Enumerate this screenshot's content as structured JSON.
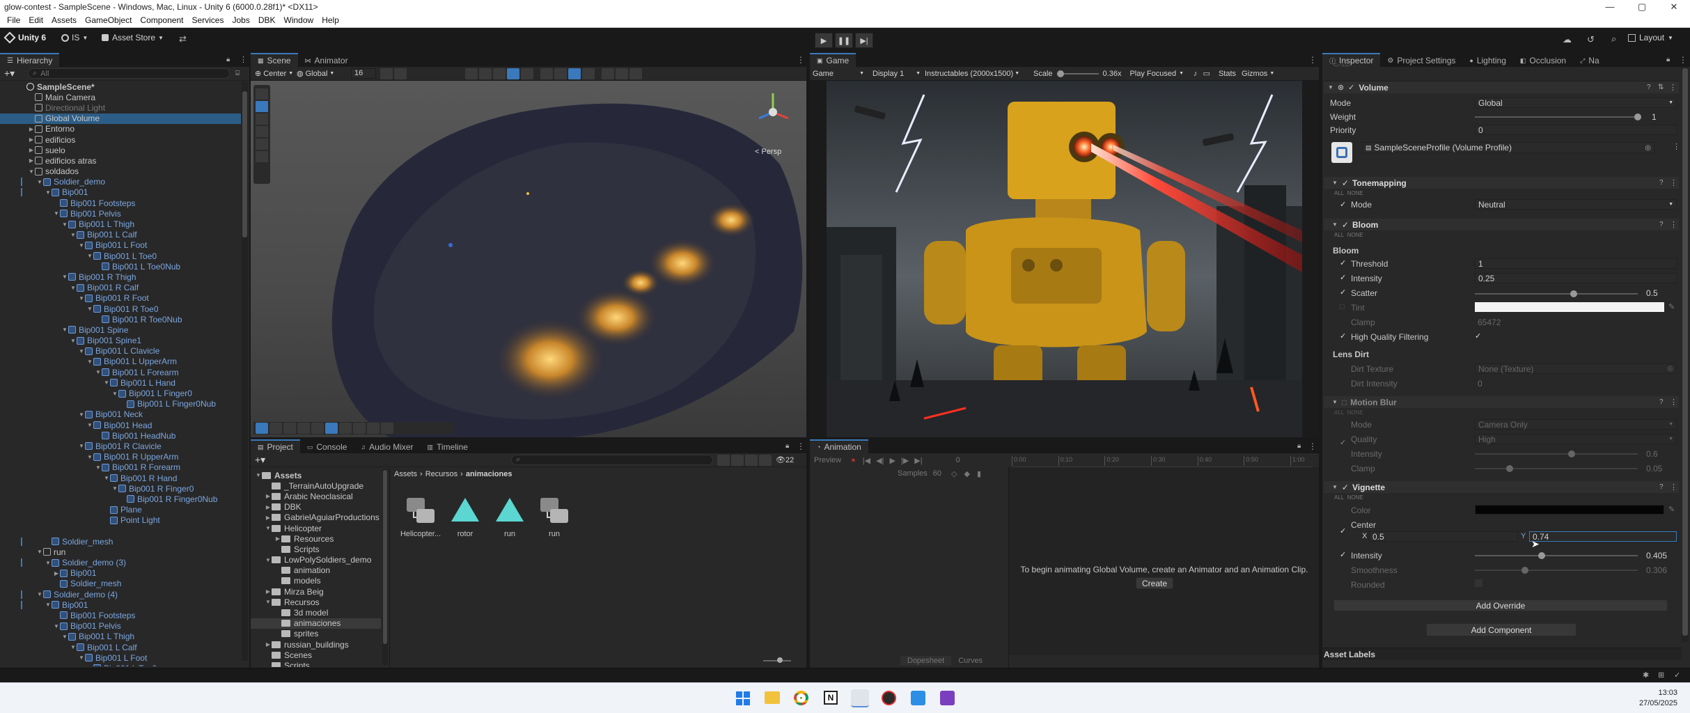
{
  "window": {
    "title": "glow-contest - SampleScene - Windows, Mac, Linux - Unity 6 (6000.0.28f1)* <DX11>",
    "min": "—",
    "max": "▢",
    "close": "✕"
  },
  "menu": [
    "File",
    "Edit",
    "Assets",
    "GameObject",
    "Component",
    "Services",
    "Jobs",
    "DBK",
    "Window",
    "Help"
  ],
  "toolbar": {
    "unity": "Unity 6",
    "account": "IS",
    "asset_store": "Asset Store",
    "layout": "Layout"
  },
  "hierarchy": {
    "tab": "Hierarchy",
    "search_placeholder": "All",
    "rows": [
      {
        "d": 0,
        "t": "SampleScene*",
        "k": "scene"
      },
      {
        "d": 1,
        "t": "Main Camera"
      },
      {
        "d": 1,
        "t": "Directional Light",
        "k": "gray"
      },
      {
        "d": 1,
        "t": "Global Volume",
        "k": "sel"
      },
      {
        "d": 1,
        "t": "Entorno",
        "a": "▶"
      },
      {
        "d": 1,
        "t": "edificios",
        "a": "▶"
      },
      {
        "d": 1,
        "t": "suelo",
        "a": "▶"
      },
      {
        "d": 1,
        "t": "edificios atras",
        "a": "▶"
      },
      {
        "d": 1,
        "t": "soldados",
        "a": "▼"
      },
      {
        "d": 2,
        "t": "Soldier_demo",
        "a": "▼",
        "k": "blue"
      },
      {
        "d": 3,
        "t": "Bip001",
        "a": "▼",
        "k": "blue"
      },
      {
        "d": 4,
        "t": "Bip001 Footsteps",
        "k": "blue"
      },
      {
        "d": 4,
        "t": "Bip001 Pelvis",
        "a": "▼",
        "k": "blue"
      },
      {
        "d": 5,
        "t": "Bip001 L Thigh",
        "a": "▼",
        "k": "blue"
      },
      {
        "d": 6,
        "t": "Bip001 L Calf",
        "a": "▼",
        "k": "blue"
      },
      {
        "d": 7,
        "t": "Bip001 L Foot",
        "a": "▼",
        "k": "blue"
      },
      {
        "d": 8,
        "t": "Bip001 L Toe0",
        "a": "▼",
        "k": "blue"
      },
      {
        "d": 9,
        "t": "Bip001 L Toe0Nub",
        "k": "blue"
      },
      {
        "d": 5,
        "t": "Bip001 R Thigh",
        "a": "▼",
        "k": "blue"
      },
      {
        "d": 6,
        "t": "Bip001 R Calf",
        "a": "▼",
        "k": "blue"
      },
      {
        "d": 7,
        "t": "Bip001 R Foot",
        "a": "▼",
        "k": "blue"
      },
      {
        "d": 8,
        "t": "Bip001 R Toe0",
        "a": "▼",
        "k": "blue"
      },
      {
        "d": 9,
        "t": "Bip001 R Toe0Nub",
        "k": "blue"
      },
      {
        "d": 5,
        "t": "Bip001 Spine",
        "a": "▼",
        "k": "blue"
      },
      {
        "d": 6,
        "t": "Bip001 Spine1",
        "a": "▼",
        "k": "blue"
      },
      {
        "d": 7,
        "t": "Bip001 L Clavicle",
        "a": "▼",
        "k": "blue"
      },
      {
        "d": 8,
        "t": "Bip001 L UpperArm",
        "a": "▼",
        "k": "blue"
      },
      {
        "d": 9,
        "t": "Bip001 L Forearm",
        "a": "▼",
        "k": "blue"
      },
      {
        "d": 10,
        "t": "Bip001 L Hand",
        "a": "▼",
        "k": "blue"
      },
      {
        "d": 11,
        "t": "Bip001 L Finger0",
        "a": "▼",
        "k": "blue"
      },
      {
        "d": 12,
        "t": "Bip001 L Finger0Nub",
        "k": "blue"
      },
      {
        "d": 7,
        "t": "Bip001 Neck",
        "a": "▼",
        "k": "blue"
      },
      {
        "d": 8,
        "t": "Bip001 Head",
        "a": "▼",
        "k": "blue"
      },
      {
        "d": 9,
        "t": "Bip001 HeadNub",
        "k": "blue"
      },
      {
        "d": 7,
        "t": "Bip001 R Clavicle",
        "a": "▼",
        "k": "blue"
      },
      {
        "d": 8,
        "t": "Bip001 R UpperArm",
        "a": "▼",
        "k": "blue"
      },
      {
        "d": 9,
        "t": "Bip001 R Forearm",
        "a": "▼",
        "k": "blue"
      },
      {
        "d": 10,
        "t": "Bip001 R Hand",
        "a": "▼",
        "k": "blue"
      },
      {
        "d": 11,
        "t": "Bip001 R Finger0",
        "a": "▼",
        "k": "blue"
      },
      {
        "d": 12,
        "t": "Bip001 R Finger0Nub",
        "k": "blue"
      },
      {
        "d": 10,
        "t": "Plane",
        "k": "blue"
      },
      {
        "d": 10,
        "t": "Point Light",
        "k": "blue"
      },
      {
        "d": 0,
        "t": "",
        "k": "blank"
      },
      {
        "d": 3,
        "t": "Soldier_mesh",
        "k": "blue"
      },
      {
        "d": 2,
        "t": "run",
        "a": "▼"
      },
      {
        "d": 3,
        "t": "Soldier_demo (3)",
        "a": "▼",
        "k": "blue"
      },
      {
        "d": 4,
        "t": "Bip001",
        "a": "▶",
        "k": "blue"
      },
      {
        "d": 4,
        "t": "Soldier_mesh",
        "k": "blue"
      },
      {
        "d": 2,
        "t": "Soldier_demo (4)",
        "a": "▼",
        "k": "blue"
      },
      {
        "d": 3,
        "t": "Bip001",
        "a": "▼",
        "k": "blue"
      },
      {
        "d": 4,
        "t": "Bip001 Footsteps",
        "k": "blue"
      },
      {
        "d": 4,
        "t": "Bip001 Pelvis",
        "a": "▼",
        "k": "blue"
      },
      {
        "d": 5,
        "t": "Bip001 L Thigh",
        "a": "▼",
        "k": "blue"
      },
      {
        "d": 6,
        "t": "Bip001 L Calf",
        "a": "▼",
        "k": "blue"
      },
      {
        "d": 7,
        "t": "Bip001 L Foot",
        "a": "▼",
        "k": "blue"
      },
      {
        "d": 8,
        "t": "Bip001 L Toe0",
        "a": "▼",
        "k": "blue"
      }
    ]
  },
  "scene": {
    "tab_scene": "Scene",
    "tab_animator": "Animator",
    "pivot": "Center",
    "space": "Global",
    "grid": "16",
    "persp": "< Persp"
  },
  "game": {
    "tab": "Game",
    "mode": "Game",
    "display": "Display 1",
    "resolution": "Instructables (2000x1500)",
    "scale_label": "Scale",
    "scale_value": "0.36x",
    "play_mode": "Play Focused",
    "stats": "Stats",
    "gizmos": "Gizmos"
  },
  "project": {
    "tab_project": "Project",
    "tab_console": "Console",
    "tab_audio": "Audio Mixer",
    "tab_timeline": "Timeline",
    "count": "22",
    "breadcrumb": [
      "Assets",
      "Recursos",
      "animaciones"
    ],
    "tree": [
      {
        "d": 0,
        "t": "Assets",
        "a": "▼",
        "b": true
      },
      {
        "d": 1,
        "t": "_TerrainAutoUpgrade"
      },
      {
        "d": 1,
        "t": "Arabic Neoclasical",
        "a": "▶"
      },
      {
        "d": 1,
        "t": "DBK",
        "a": "▶"
      },
      {
        "d": 1,
        "t": "GabrielAguiarProductions",
        "a": "▶"
      },
      {
        "d": 1,
        "t": "Helicopter",
        "a": "▼"
      },
      {
        "d": 2,
        "t": "Resources",
        "a": "▶"
      },
      {
        "d": 2,
        "t": "Scripts"
      },
      {
        "d": 1,
        "t": "LowPolySoldiers_demo",
        "a": "▼"
      },
      {
        "d": 2,
        "t": "animation"
      },
      {
        "d": 2,
        "t": "models"
      },
      {
        "d": 1,
        "t": "Mirza Beig",
        "a": "▶"
      },
      {
        "d": 1,
        "t": "Recursos",
        "a": "▼"
      },
      {
        "d": 2,
        "t": "3d model"
      },
      {
        "d": 2,
        "t": "animaciones",
        "sel": true
      },
      {
        "d": 2,
        "t": "sprites"
      },
      {
        "d": 1,
        "t": "russian_buildings",
        "a": "▶"
      },
      {
        "d": 1,
        "t": "Scenes"
      },
      {
        "d": 1,
        "t": "Scripts"
      }
    ],
    "assets": [
      "Helicopter...",
      "rotor",
      "run",
      "run"
    ]
  },
  "animation": {
    "tab": "Animation",
    "preview": "Preview",
    "samples_label": "Samples",
    "samples": "60",
    "frame": "0",
    "ticks": [
      "0:00",
      "0:10",
      "0:20",
      "0:30",
      "0:40",
      "0:50",
      "1:00"
    ],
    "message": "To begin animating Global Volume, create an Animator and an Animation Clip.",
    "create": "Create",
    "dopesheet": "Dopesheet",
    "curves": "Curves"
  },
  "inspector": {
    "tab": "Inspector",
    "tab_settings": "Project Settings",
    "tab_lighting": "Lighting",
    "tab_occlusion": "Occlusion",
    "tab_nav": "Na",
    "scale_cut": "Scale",
    "component": "Volume",
    "mode_label": "Mode",
    "mode": "Global",
    "weight_label": "Weight",
    "weight": "1",
    "priority_label": "Priority",
    "priority": "0",
    "profile": "SampleSceneProfile (Volume Profile)",
    "all": "ALL",
    "none": "NONE",
    "tonemapping": {
      "title": "Tonemapping",
      "mode_label": "Mode",
      "mode": "Neutral"
    },
    "bloom": {
      "title": "Bloom",
      "sub": "Bloom",
      "threshold_label": "Threshold",
      "threshold": "1",
      "intensity_label": "Intensity",
      "intensity": "0.25",
      "scatter_label": "Scatter",
      "scatter": "0.5",
      "scatter_frac": 0.61,
      "tint_label": "Tint",
      "clamp_label": "Clamp",
      "clamp": "65472",
      "hq_label": "High Quality Filtering",
      "lens": "Lens Dirt",
      "dirt_tex_label": "Dirt Texture",
      "dirt_tex": "None (Texture)",
      "dirt_int_label": "Dirt Intensity",
      "dirt_int": "0"
    },
    "motion": {
      "title": "Motion Blur",
      "mode_label": "Mode",
      "mode": "Camera Only",
      "quality_label": "Quality",
      "quality": "High",
      "intensity_label": "Intensity",
      "intensity": "0.6",
      "intensity_frac": 0.6,
      "clamp_label": "Clamp",
      "clamp": "0.05",
      "clamp_frac": 0.2
    },
    "vignette": {
      "title": "Vignette",
      "color_label": "Color",
      "center_label": "Center",
      "x_label": "X",
      "x": "0.5",
      "y_label": "Y",
      "y": "0.74",
      "intensity_label": "Intensity",
      "intensity": "0.405",
      "intensity_frac": 0.405,
      "smooth_label": "Smoothness",
      "smooth": "0.306",
      "smooth_frac": 0.3,
      "rounded_label": "Rounded"
    },
    "add_override": "Add Override",
    "add_component": "Add Component",
    "asset_labels": "Asset Labels"
  },
  "taskbar": {
    "time": "13:03",
    "date": "27/05/2025"
  },
  "colors": {
    "accent": "#3a79bb",
    "selection": "#2c5d87",
    "prefab": "#7ba6e0"
  }
}
